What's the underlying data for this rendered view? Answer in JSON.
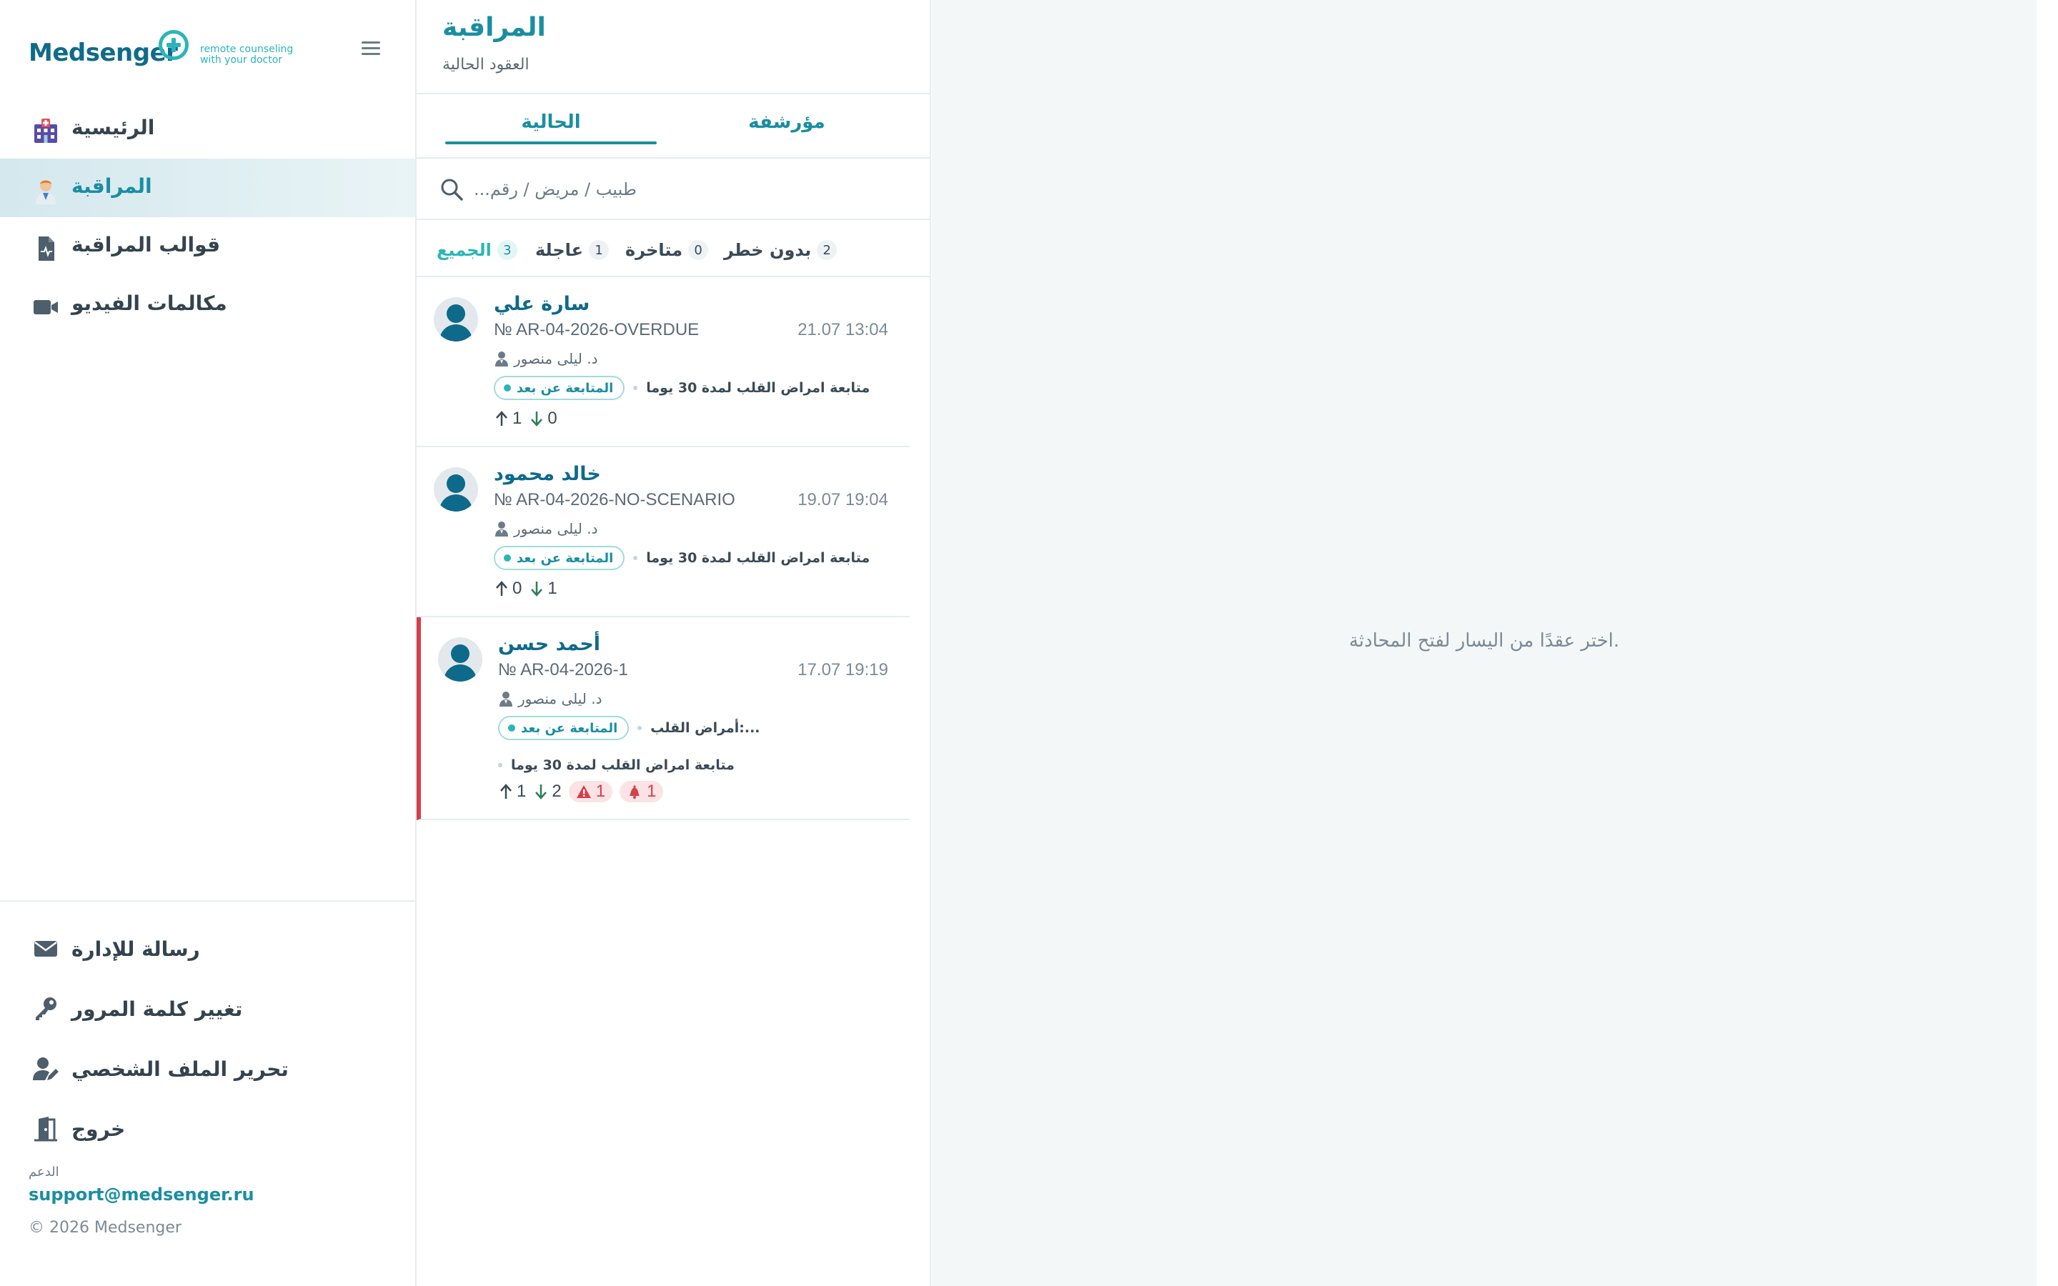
{
  "brand": {
    "name": "Medsenger",
    "tagline_line1": "remote counseling",
    "tagline_line2": "with your doctor",
    "accent_color": "#2bb5b8",
    "primary_color": "#106b8a"
  },
  "sidebar": {
    "items": [
      {
        "label": "الرئيسية",
        "icon": "hospital-icon",
        "active": false
      },
      {
        "label": "المراقبة",
        "icon": "doctor-icon",
        "active": true
      },
      {
        "label": "قوالب المراقبة",
        "icon": "monitoring-template-icon",
        "active": false
      },
      {
        "label": "مكالمات الفيديو",
        "icon": "video-camera-icon",
        "active": false
      }
    ],
    "bottom_items": [
      {
        "label": "رسالة للإدارة",
        "icon": "envelope-icon"
      },
      {
        "label": "تغيير كلمة المرور",
        "icon": "key-icon"
      },
      {
        "label": "تحرير الملف الشخصي",
        "icon": "edit-profile-icon"
      },
      {
        "label": "خروج",
        "icon": "exit-door-icon"
      }
    ],
    "support_label": "الدعم",
    "support_email": "support@medsenger.ru",
    "copyright": "© 2026 Medsenger"
  },
  "contracts_panel": {
    "title": "المراقبة",
    "subtitle": "العقود الحالية",
    "tabs": [
      {
        "label": "الحالية",
        "active": true
      },
      {
        "label": "مؤرشفة",
        "active": false
      }
    ],
    "search_placeholder": "طبيب / مريض / رقم...",
    "filters": [
      {
        "label": "الجميع",
        "count": "3",
        "active": true
      },
      {
        "label": "عاجلة",
        "count": "1",
        "active": false
      },
      {
        "label": "متاخرة",
        "count": "0",
        "active": false
      },
      {
        "label": "بدون خطر",
        "count": "2",
        "active": false
      }
    ],
    "contracts": [
      {
        "name": "سارة علي",
        "number": "№ AR-04-2026-OVERDUE",
        "date": "21.07 13:04",
        "doctor": "د. ليلى منصور",
        "status_tag": "المتابعة عن بعد",
        "scenario": "متابعة امراض القلب لمدة 30 يوما",
        "scenario_extra": "",
        "sent": "1",
        "received": "0",
        "warnings": "",
        "alerts": "",
        "urgent": false
      },
      {
        "name": "خالد محمود",
        "number": "№ AR-04-2026-NO-SCENARIO",
        "date": "19.07 19:04",
        "doctor": "د. ليلى منصور",
        "status_tag": "المتابعة عن بعد",
        "scenario": "متابعة امراض القلب لمدة 30 يوما",
        "scenario_extra": "",
        "sent": "0",
        "received": "1",
        "warnings": "",
        "alerts": "",
        "urgent": false
      },
      {
        "name": "أحمد حسن",
        "number": "№ AR-04-2026-1",
        "date": "17.07 19:19",
        "doctor": "د. ليلى منصور",
        "status_tag": "المتابعة عن بعد",
        "scenario": "أمراض القلب:...",
        "scenario_extra": "متابعة امراض القلب لمدة 30 يوما",
        "sent": "1",
        "received": "2",
        "warnings": "1",
        "alerts": "1",
        "urgent": true
      }
    ]
  },
  "chat": {
    "empty_message": "اختر عقدًا من اليسار لفتح المحادثة."
  }
}
